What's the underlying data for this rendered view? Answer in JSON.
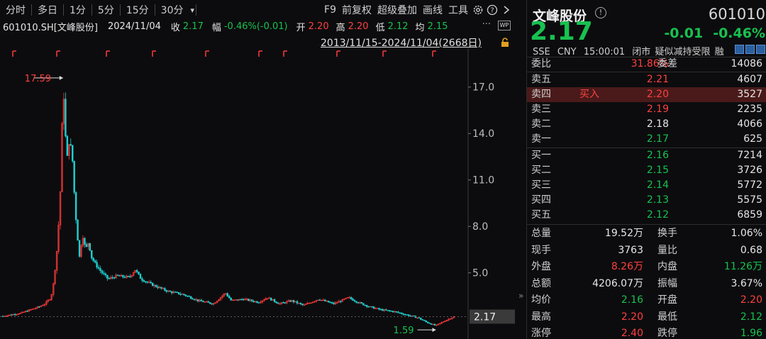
{
  "toolbar": {
    "tabs": [
      "分时",
      "多日",
      "1分",
      "5分",
      "15分",
      "30分"
    ],
    "dropdown_glyph": "▾",
    "right_items": [
      "F9",
      "前复权",
      "超级叠加",
      "画线",
      "工具"
    ],
    "icons": [
      "gear-icon",
      "help-icon",
      "chevron-right-icon"
    ]
  },
  "infobar": {
    "symbol": "601010.SH[文峰股份]",
    "date": "2024/11/04",
    "close_label": "收",
    "close": "2.17",
    "amp_label": "幅",
    "amp": "-0.46%(-0.01)",
    "open_label": "开",
    "open": "2.20",
    "high_label": "高",
    "high": "2.20",
    "low_label": "低",
    "low": "2.12",
    "avg_label": "均",
    "avg": "2.15",
    "more": "···",
    "wp": "WP"
  },
  "range": "2013/11/15-2024/11/04(2668日)",
  "chart_data": {
    "type": "candlestick",
    "yaxis_ticks": [
      "17.0",
      "14.0",
      "11.0",
      "8.0",
      "5.0"
    ],
    "ylim": [
      1.0,
      18.5
    ],
    "max_label": "17.59",
    "min_label": "1.59",
    "last_price_label": "2.17",
    "series": [
      {
        "t": 0,
        "c": 2.2
      },
      {
        "t": 3,
        "c": 2.3
      },
      {
        "t": 6,
        "c": 2.4
      },
      {
        "t": 9,
        "c": 2.6
      },
      {
        "t": 12,
        "c": 2.8
      },
      {
        "t": 14,
        "c": 3.0
      },
      {
        "t": 16,
        "c": 3.4
      },
      {
        "t": 17,
        "c": 4.5
      },
      {
        "t": 18,
        "c": 6.5
      },
      {
        "t": 19,
        "c": 9.5
      },
      {
        "t": 19.6,
        "c": 13.5
      },
      {
        "t": 20,
        "c": 17.59
      },
      {
        "t": 20.6,
        "c": 15.0
      },
      {
        "t": 21.2,
        "c": 12.0
      },
      {
        "t": 22,
        "c": 13.5
      },
      {
        "t": 23,
        "c": 12.8
      },
      {
        "t": 23.8,
        "c": 10.0
      },
      {
        "t": 24.5,
        "c": 8.0
      },
      {
        "t": 25.5,
        "c": 6.0
      },
      {
        "t": 26.5,
        "c": 7.5
      },
      {
        "t": 27.5,
        "c": 6.5
      },
      {
        "t": 28.5,
        "c": 7.0
      },
      {
        "t": 29.5,
        "c": 6.0
      },
      {
        "t": 31,
        "c": 5.5
      },
      {
        "t": 33,
        "c": 5.0
      },
      {
        "t": 35,
        "c": 4.6
      },
      {
        "t": 38,
        "c": 4.8
      },
      {
        "t": 42,
        "c": 4.7
      },
      {
        "t": 44,
        "c": 5.2
      },
      {
        "t": 46,
        "c": 4.6
      },
      {
        "t": 50,
        "c": 4.2
      },
      {
        "t": 55,
        "c": 3.8
      },
      {
        "t": 60,
        "c": 3.6
      },
      {
        "t": 65,
        "c": 3.2
      },
      {
        "t": 70,
        "c": 3.0
      },
      {
        "t": 74,
        "c": 3.7
      },
      {
        "t": 76,
        "c": 3.2
      },
      {
        "t": 80,
        "c": 3.3
      },
      {
        "t": 85,
        "c": 3.1
      },
      {
        "t": 88,
        "c": 3.4
      },
      {
        "t": 92,
        "c": 3.0
      },
      {
        "t": 96,
        "c": 3.2
      },
      {
        "t": 100,
        "c": 2.9
      },
      {
        "t": 105,
        "c": 3.3
      },
      {
        "t": 110,
        "c": 3.0
      },
      {
        "t": 115,
        "c": 3.4
      },
      {
        "t": 118,
        "c": 3.1
      },
      {
        "t": 122,
        "c": 2.8
      },
      {
        "t": 126,
        "c": 2.6
      },
      {
        "t": 130,
        "c": 2.5
      },
      {
        "t": 134,
        "c": 2.3
      },
      {
        "t": 138,
        "c": 2.1
      },
      {
        "t": 141,
        "c": 1.8
      },
      {
        "t": 144,
        "c": 1.59
      },
      {
        "t": 147,
        "c": 1.9
      },
      {
        "t": 150,
        "c": 2.17
      }
    ]
  },
  "quote": {
    "name": "文峰股份",
    "code": "601010",
    "price": "2.17",
    "change": "-0.01",
    "change_pct": "-0.46%",
    "meta": [
      "SSE",
      "CNY",
      "15:00:01",
      "闭市",
      "疑似减持受限",
      "融"
    ],
    "weibi_label": "委比",
    "weibi": "31.86%",
    "weicha_label": "委差",
    "weicha": "14086",
    "sell": [
      {
        "label": "卖五",
        "price": "2.21",
        "vol": "4607",
        "color": "red"
      },
      {
        "label": "卖四",
        "price": "2.20",
        "vol": "3527",
        "color": "red",
        "tag": "买入"
      },
      {
        "label": "卖三",
        "price": "2.19",
        "vol": "2235",
        "color": "red"
      },
      {
        "label": "卖二",
        "price": "2.18",
        "vol": "4066",
        "color": "white"
      },
      {
        "label": "卖一",
        "price": "2.17",
        "vol": "625",
        "color": "green"
      }
    ],
    "buy": [
      {
        "label": "买一",
        "price": "2.16",
        "vol": "7214",
        "color": "green"
      },
      {
        "label": "买二",
        "price": "2.15",
        "vol": "3726",
        "color": "green"
      },
      {
        "label": "买三",
        "price": "2.14",
        "vol": "5772",
        "color": "green"
      },
      {
        "label": "买四",
        "price": "2.13",
        "vol": "5575",
        "color": "green"
      },
      {
        "label": "买五",
        "price": "2.12",
        "vol": "6859",
        "color": "green"
      }
    ],
    "stats": [
      {
        "l1": "总量",
        "v1": "19.52万",
        "c1": "white",
        "l2": "换手",
        "v2": "1.06%",
        "c2": "white"
      },
      {
        "l1": "现手",
        "v1": "3763",
        "c1": "white",
        "l2": "量比",
        "v2": "0.68",
        "c2": "white"
      },
      {
        "l1": "外盘",
        "v1": "8.26万",
        "c1": "red",
        "l2": "内盘",
        "v2": "11.26万",
        "c2": "green"
      },
      {
        "l1": "总额",
        "v1": "4206.07万",
        "c1": "white",
        "l2": "振幅",
        "v2": "3.67%",
        "c2": "white"
      },
      {
        "l1": "均价",
        "v1": "2.16",
        "c1": "green",
        "l2": "开盘",
        "v2": "2.20",
        "c2": "red"
      },
      {
        "l1": "最高",
        "v1": "2.20",
        "c1": "red",
        "l2": "最低",
        "v2": "2.12",
        "c2": "green"
      },
      {
        "l1": "涨停",
        "v1": "2.40",
        "c1": "red",
        "l2": "跌停",
        "v2": "1.96",
        "c2": "green"
      }
    ]
  },
  "collapse": "»"
}
